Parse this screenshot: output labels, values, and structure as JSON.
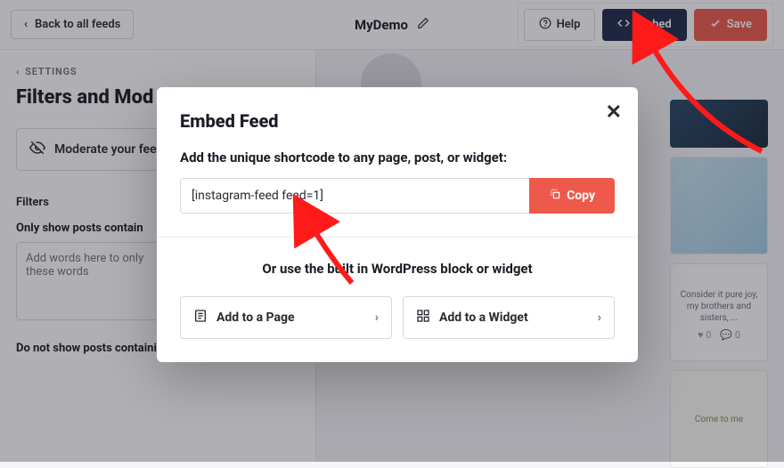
{
  "topbar": {
    "back_label": "Back to all feeds",
    "title": "MyDemo",
    "help_label": "Help",
    "embed_label": "Embed",
    "save_label": "Save"
  },
  "sidebar": {
    "crumb": "SETTINGS",
    "heading": "Filters and Mod",
    "moderate_label": "Moderate your fee",
    "filters_section": "Filters",
    "only_show_label": "Only show posts contain",
    "only_show_placeholder": "Add words here to only\nthese words",
    "do_not_label": "Do not show posts containing"
  },
  "preview": {
    "tile2_caption": "Consider it pure joy, my brothers and sisters, ...",
    "tile2_like": "0",
    "tile2_comment": "0",
    "tile3_text": "Come to me"
  },
  "modal": {
    "title": "Embed Feed",
    "subtitle": "Add the unique shortcode to any page, post, or widget:",
    "shortcode": "[instagram-feed feed=1]",
    "copy_label": "Copy",
    "or_text": "Or use the built in WordPress block or widget",
    "add_page_label": "Add to a Page",
    "add_widget_label": "Add to a Widget"
  },
  "colors": {
    "accent": "#ed5a4c",
    "dark": "#1f2a4a"
  }
}
